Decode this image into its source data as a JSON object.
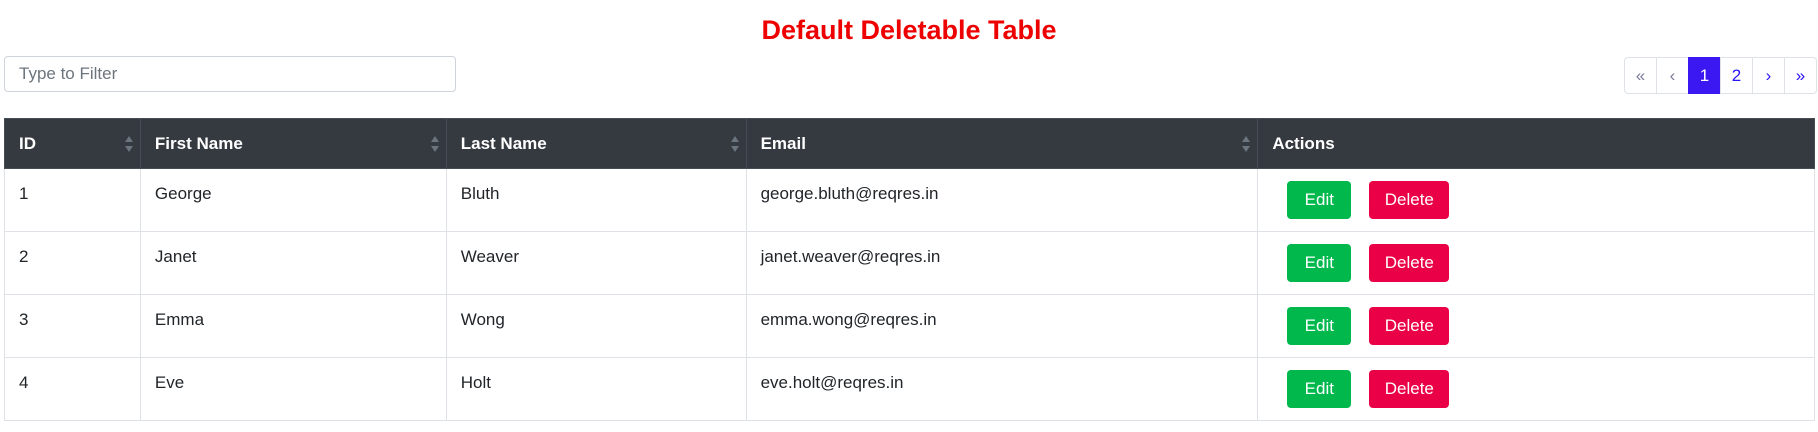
{
  "page": {
    "title": "Default Deletable Table"
  },
  "filter": {
    "placeholder": "Type to Filter",
    "value": ""
  },
  "pagination": {
    "first": "«",
    "prev": "‹",
    "pages": [
      "1",
      "2"
    ],
    "active_page": "1",
    "next": "›",
    "last": "»"
  },
  "table": {
    "columns": [
      "ID",
      "First Name",
      "Last Name",
      "Email",
      "Actions"
    ],
    "rows": [
      {
        "id": "1",
        "first_name": "George",
        "last_name": "Bluth",
        "email": "george.bluth@reqres.in"
      },
      {
        "id": "2",
        "first_name": "Janet",
        "last_name": "Weaver",
        "email": "janet.weaver@reqres.in"
      },
      {
        "id": "3",
        "first_name": "Emma",
        "last_name": "Wong",
        "email": "emma.wong@reqres.in"
      },
      {
        "id": "4",
        "first_name": "Eve",
        "last_name": "Holt",
        "email": "eve.holt@reqres.in"
      }
    ],
    "actions": {
      "edit_label": "Edit",
      "delete_label": "Delete"
    }
  },
  "colors": {
    "title": "#ee0000",
    "header_bg": "#343a40",
    "edit": "#00b84c",
    "delete": "#ea0046",
    "active_page": "#3b18f2",
    "link": "#2a13f5"
  },
  "icons": {
    "sort": "sort-icon"
  }
}
